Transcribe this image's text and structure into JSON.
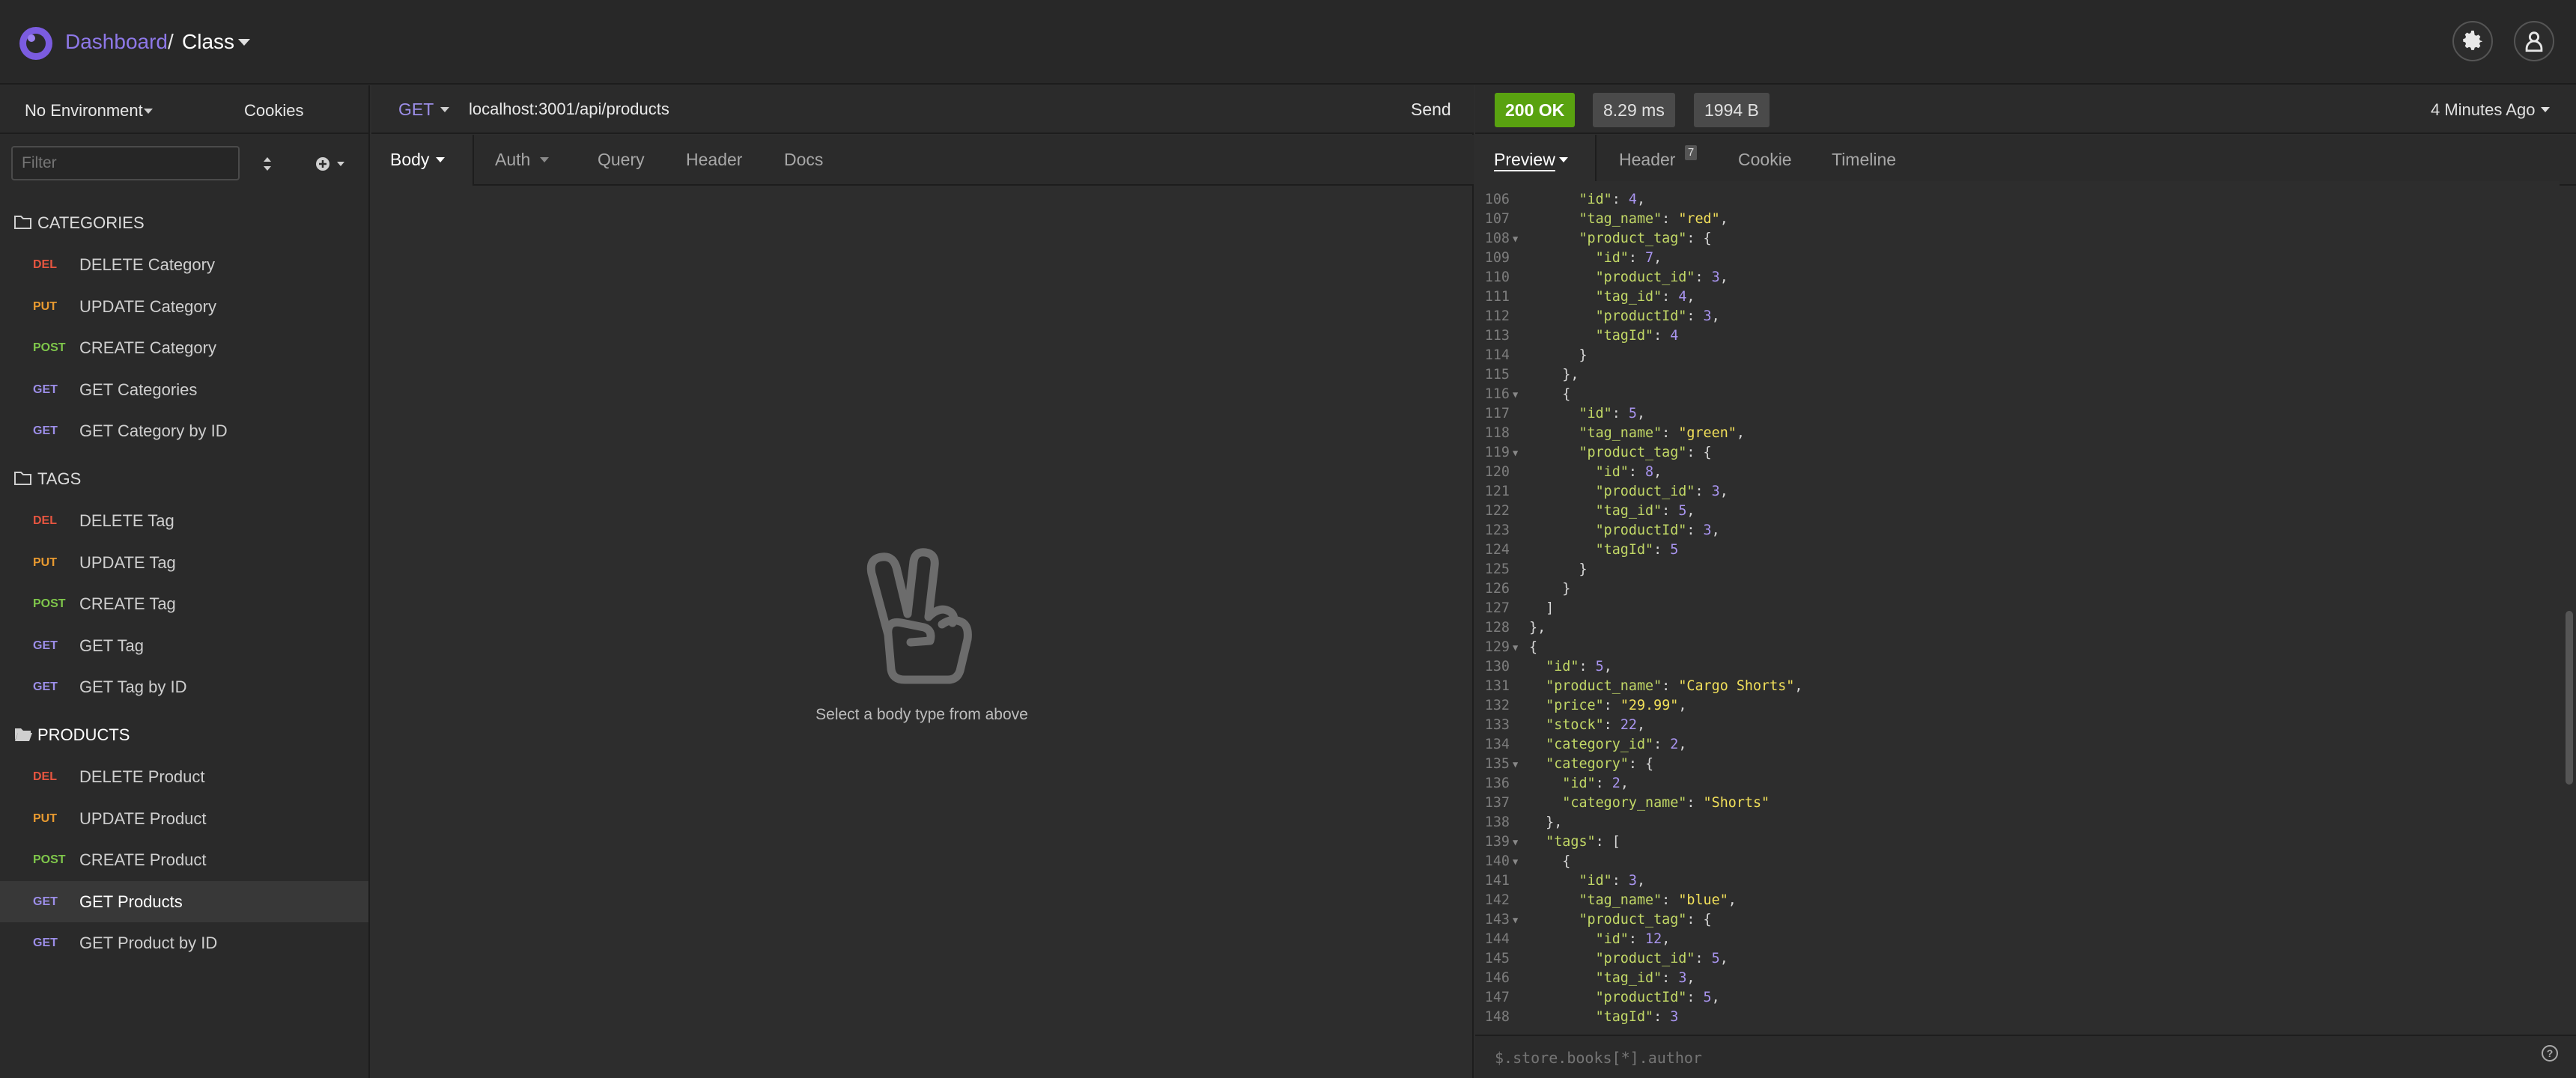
{
  "app": {
    "breadcrumb_root": "Dashboard",
    "breadcrumb_sep": "/",
    "workspace": "Class"
  },
  "sidebar": {
    "environment": "No Environment",
    "cookies": "Cookies",
    "filter_placeholder": "Filter",
    "folders": [
      {
        "name": "CATEGORIES",
        "open": false,
        "requests": [
          {
            "method": "DEL",
            "name": "DELETE Category"
          },
          {
            "method": "PUT",
            "name": "UPDATE Category"
          },
          {
            "method": "POST",
            "name": "CREATE Category"
          },
          {
            "method": "GET",
            "name": "GET Categories"
          },
          {
            "method": "GET",
            "name": "GET Category by ID"
          }
        ]
      },
      {
        "name": "TAGS",
        "open": false,
        "requests": [
          {
            "method": "DEL",
            "name": "DELETE Tag"
          },
          {
            "method": "PUT",
            "name": "UPDATE Tag"
          },
          {
            "method": "POST",
            "name": "CREATE Tag"
          },
          {
            "method": "GET",
            "name": "GET Tag"
          },
          {
            "method": "GET",
            "name": "GET Tag by ID"
          }
        ]
      },
      {
        "name": "PRODUCTS",
        "open": true,
        "requests": [
          {
            "method": "DEL",
            "name": "DELETE Product"
          },
          {
            "method": "PUT",
            "name": "UPDATE Product"
          },
          {
            "method": "POST",
            "name": "CREATE Product"
          },
          {
            "method": "GET",
            "name": "GET Products",
            "active": true
          },
          {
            "method": "GET",
            "name": "GET Product by ID"
          }
        ]
      }
    ]
  },
  "request": {
    "method": "GET",
    "url": "localhost:3001/api/products",
    "send": "Send",
    "tabs": [
      "Body",
      "Auth",
      "Query",
      "Header",
      "Docs"
    ],
    "empty_message": "Select a body type from above"
  },
  "response": {
    "status": "200 OK",
    "time": "8.29 ms",
    "size": "1994 B",
    "age": "4 Minutes Ago",
    "tabs": {
      "preview": "Preview",
      "header": "Header",
      "header_count": "7",
      "cookie": "Cookie",
      "timeline": "Timeline"
    },
    "filter_placeholder": "$.store.books[*].author",
    "help": "?",
    "first_line": 106,
    "lines": [
      "      \"id\": 4,",
      "      \"tag_name\": \"red\",",
      "      \"product_tag\": {",
      "        \"id\": 7,",
      "        \"product_id\": 3,",
      "        \"tag_id\": 4,",
      "        \"productId\": 3,",
      "        \"tagId\": 4",
      "      }",
      "    },",
      "    {",
      "      \"id\": 5,",
      "      \"tag_name\": \"green\",",
      "      \"product_tag\": {",
      "        \"id\": 8,",
      "        \"product_id\": 3,",
      "        \"tag_id\": 5,",
      "        \"productId\": 3,",
      "        \"tagId\": 5",
      "      }",
      "    }",
      "  ]",
      "},",
      "{",
      "  \"id\": 5,",
      "  \"product_name\": \"Cargo Shorts\",",
      "  \"price\": \"29.99\",",
      "  \"stock\": 22,",
      "  \"category_id\": 2,",
      "  \"category\": {",
      "    \"id\": 2,",
      "    \"category_name\": \"Shorts\"",
      "  },",
      "  \"tags\": [",
      "    {",
      "      \"id\": 3,",
      "      \"tag_name\": \"blue\",",
      "      \"product_tag\": {",
      "        \"id\": 12,",
      "        \"product_id\": 5,",
      "        \"tag_id\": 3,",
      "        \"productId\": 5,",
      "        \"tagId\": 3"
    ],
    "fold_lines": [
      108,
      116,
      119,
      129,
      135,
      139,
      140,
      143
    ]
  },
  "colors": {
    "accent": "#7b5ce0",
    "status_ok": "#59a210",
    "del": "#e65540",
    "put": "#e89a30",
    "post": "#7fc74b",
    "get": "#9c8ee8",
    "json_key": "#c2d866",
    "json_string": "#f2e05a",
    "json_number": "#a995f0"
  },
  "icons": [
    "settings-gear-icon",
    "account-icon",
    "folder-icon",
    "folder-open-icon",
    "sort-icon",
    "add-menu-icon",
    "peace-hand-icon"
  ]
}
